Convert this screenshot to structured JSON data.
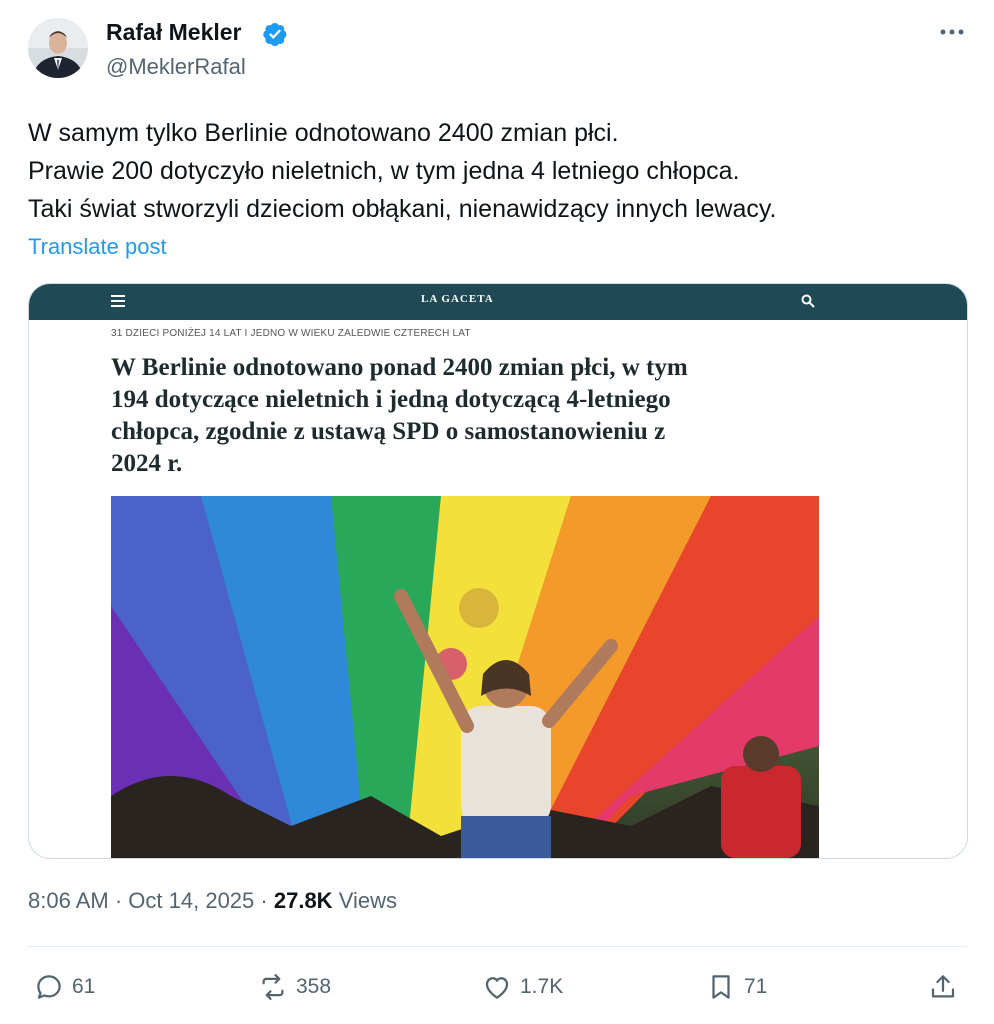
{
  "author": {
    "name": "Rafał Mekler",
    "handle": "@MeklerRafal",
    "verified": true,
    "verified_color": "#1d9bf0"
  },
  "post": {
    "lines": [
      "W samym tylko Berlinie odnotowano 2400 zmian płci.",
      "Prawie 200 dotyczyło nieletnich, w tym jedna 4 letniego chłopca.",
      "Taki świat stworzyli dzieciom obłąkani, nienawidzący innych lewacy."
    ],
    "translate_label": "Translate post"
  },
  "card": {
    "site_logo": "LA GACETA",
    "kicker": "31 DZIECI PONIŻEJ 14 LAT I JEDNO W WIEKU ZALEDWIE CZTERECH LAT",
    "headline_lines": [
      "W Berlinie odnotowano ponad 2400 zmian płci, w tym",
      "194 dotyczące nieletnich i jedną dotyczącą 4-letniego",
      "chłopca, zgodnie z ustawą SPD o samostanowieniu z",
      "2024 r."
    ],
    "bar_color": "#1f4a55"
  },
  "meta": {
    "time": "8:06 AM",
    "date": "Oct 14, 2025",
    "views_count": "27.8K",
    "views_label": "Views"
  },
  "actions": {
    "replies": "61",
    "reposts": "358",
    "likes": "1.7K",
    "bookmarks": "71"
  },
  "icons": [
    "more-icon",
    "verified-icon",
    "menu-icon",
    "search-icon",
    "reply-icon",
    "repost-icon",
    "like-icon",
    "bookmark-icon",
    "share-icon"
  ]
}
